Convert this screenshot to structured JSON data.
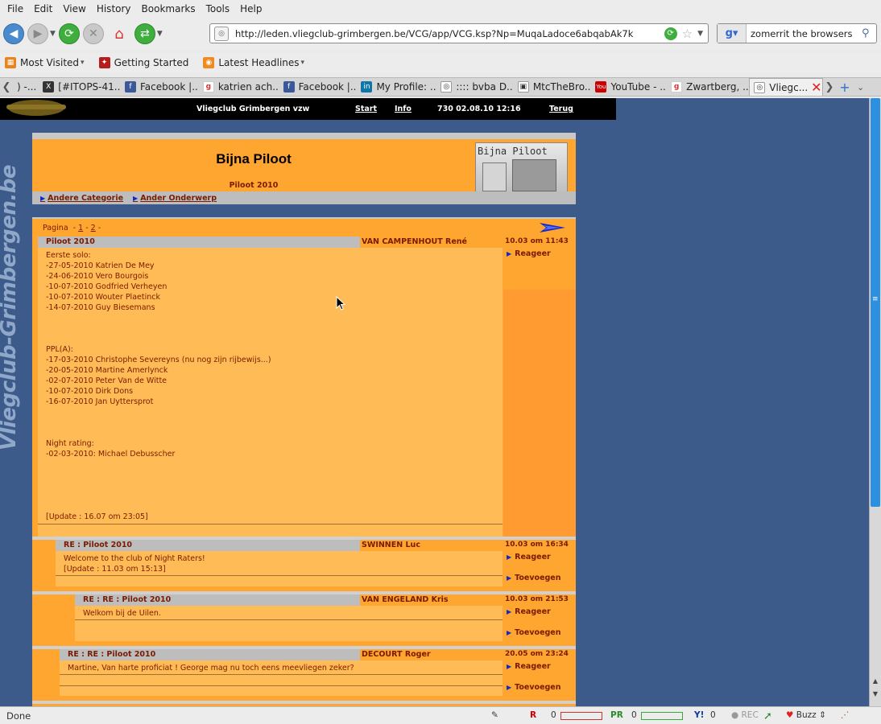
{
  "menubar": {
    "items": [
      {
        "u": "F",
        "rest": "ile"
      },
      {
        "u": "E",
        "rest": "dit"
      },
      {
        "u": "V",
        "rest": "iew"
      },
      {
        "u": "",
        "pre": "Hi",
        "us": "s",
        "rest": "tory"
      },
      {
        "u": "B",
        "rest": "ookmarks"
      },
      {
        "u": "T",
        "rest": "ools"
      },
      {
        "u": "H",
        "rest": "elp"
      }
    ],
    "labels": [
      "File",
      "Edit",
      "View",
      "History",
      "Bookmarks",
      "Tools",
      "Help"
    ]
  },
  "nav": {
    "url": "http://leden.vliegclub-grimbergen.be/VCG/app/VCG.ksp?Np=MuqaLadoce6abqabAk7k",
    "search_query": "zomerrit the browsers"
  },
  "bookmarks": [
    "Most Visited",
    "Getting Started",
    "Latest Headlines"
  ],
  "tabs": [
    {
      "label": ") -...",
      "fav": "",
      "cls": ""
    },
    {
      "label": "[#ITOPS-41...",
      "fav": "X",
      "cls": "fav-x"
    },
    {
      "label": "Facebook |...",
      "fav": "f",
      "cls": "fav-fb"
    },
    {
      "label": "katrien ach...",
      "fav": "g",
      "cls": "fav-g"
    },
    {
      "label": "Facebook |...",
      "fav": "f",
      "cls": "fav-fb"
    },
    {
      "label": "My Profile: ...",
      "fav": "in",
      "cls": "fav-in"
    },
    {
      "label": ":::: bvba D...",
      "fav": "◎",
      "cls": "fav-gen"
    },
    {
      "label": "MtcTheBro...",
      "fav": "▣",
      "cls": "fav-gen"
    },
    {
      "label": "YouTube - ...",
      "fav": "You",
      "cls": "fav-yt"
    },
    {
      "label": "Zwartberg, ...",
      "fav": "g",
      "cls": "fav-g"
    },
    {
      "label": "Vliegc...",
      "fav": "◎",
      "cls": "fav-gen",
      "active": true
    }
  ],
  "status": {
    "text": "Done",
    "rec_label": "REC",
    "buzz_label": "Buzz",
    "count_r1": "0",
    "count_r2": "0",
    "count_y": "0"
  },
  "site": {
    "name": "Vliegclub Grimbergen vzw",
    "nav_start": "Start",
    "nav_info": "Info",
    "session": "730 02.08.10 12:16",
    "nav_back": "Terug",
    "vertical_brand": "Vliegclub-Grimbergen.be"
  },
  "page": {
    "title": "Bijna Piloot",
    "subtitle": "Piloot 2010",
    "image_text": "Bijna Piloot",
    "cat_other": "Andere Categorie",
    "cat_other_topic": "Ander Onderwerp",
    "pager_label": "Pagina",
    "pager_p1": "1",
    "pager_p2": "2"
  },
  "posts": [
    {
      "subject": "Piloot 2010",
      "author": "VAN CAMPENHOUT René",
      "time": "10.03 om 11:43",
      "actions": [
        "Reageer"
      ],
      "body": "Eerste solo:\n-27-05-2010 Katrien De Mey\n-24-06-2010 Vero Bourgois\n-10-07-2010 Godfried Verheyen\n-10-07-2010 Wouter Plaetinck\n-14-07-2010 Guy Biesemans\n\n\n\nPPL(A):\n-17-03-2010 Christophe Severeyns (nu nog zijn rijbewijs...)\n-20-05-2010 Martine Amerlynck\n-02-07-2010 Peter Van de Witte\n-10-07-2010 Dirk Dons\n-16-07-2010 Jan Uyttersprot\n\n\n\nNight rating:\n-02-03-2010: Michael Debusscher\n\n\n\n\n\n[Update : 16.07 om 23:05]"
    },
    {
      "subject": "RE : Piloot 2010",
      "author": "SWINNEN Luc",
      "time": "10.03 om 16:34",
      "actions": [
        "Reageer",
        "Toevoegen"
      ],
      "body": "Welcome to the club of Night Raters!\n[Update : 11.03 om 15:13]"
    },
    {
      "subject": "RE : RE : Piloot 2010",
      "author": "VAN ENGELAND Kris",
      "time": "10.03 om 21:53",
      "actions": [
        "Reageer",
        "Toevoegen"
      ],
      "body": "Welkom bij de Uilen."
    },
    {
      "subject": "RE : RE : Piloot 2010",
      "author": "DECOURT Roger",
      "time": "20.05 om 23:24",
      "actions": [
        "Reageer",
        "Toevoegen"
      ],
      "body": "Martine, Van harte proficiat ! George mag nu toch eens meevliegen zeker?"
    }
  ],
  "colors": {
    "page_bg": "#3d5b8a",
    "panel_orange": "#ffa630",
    "post_bg": "#ffbb55",
    "header_grey": "#bdbdbd",
    "text_brown": "#7a1b00",
    "arrow_blue": "#1428c8"
  }
}
